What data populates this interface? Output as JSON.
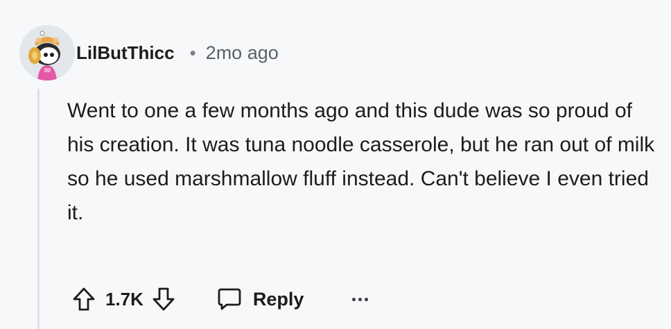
{
  "comment": {
    "username": "LilButThicc",
    "separator": "•",
    "timestamp": "2mo ago",
    "body": "Went to one a few months ago and this dude was so proud of his creation. It was tuna noodle casserole, but he ran out of milk so he used marshmallow fluff instead. Can't believe I even tried it.",
    "votes": "1.7K",
    "reply_label": "Reply"
  },
  "icons": {
    "avatar": "snoo-avatar",
    "upvote": "arrow-up-outline-icon",
    "downvote": "arrow-down-outline-icon",
    "reply": "speech-bubble-icon",
    "more": "ellipsis-icon"
  },
  "colors": {
    "background": "#f7f8fa",
    "text": "#1c1c1c",
    "muted": "#5c6066",
    "thread_line": "#dfe1e5"
  }
}
